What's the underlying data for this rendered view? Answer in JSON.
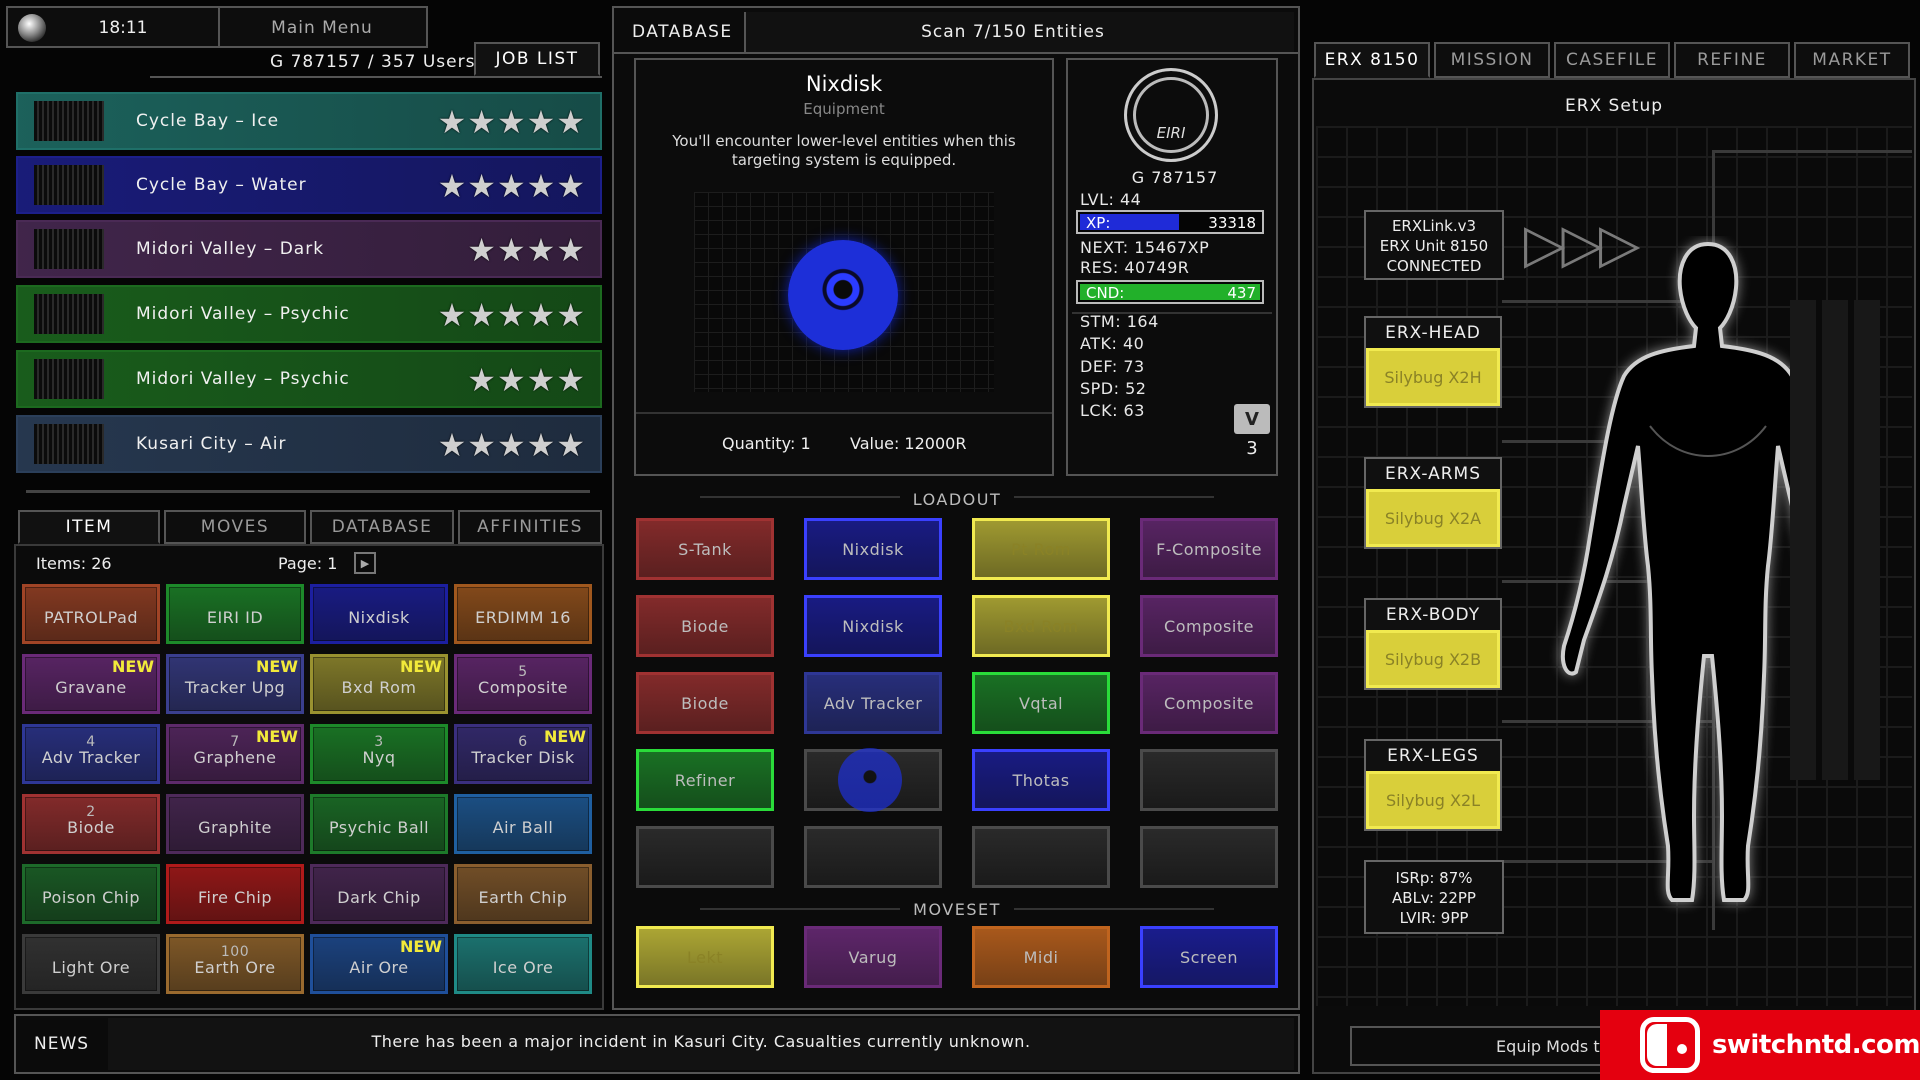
{
  "topbar": {
    "time": "18:11",
    "main_menu": "Main Menu",
    "users": "G 787157 / 357 Users",
    "job_list_tab": "JOB LIST"
  },
  "jobs": [
    {
      "name": "Cycle Bay – Ice",
      "stars": "★★★★★",
      "color": "#1f6f68"
    },
    {
      "name": "Cycle Bay – Water",
      "stars": "★★★★★",
      "color": "#1c1f8a"
    },
    {
      "name": "Midori Valley – Dark",
      "stars": "★★★★",
      "color": "#4a2a55"
    },
    {
      "name": "Midori Valley – Psychic",
      "stars": "★★★★★",
      "color": "#1c6a1f"
    },
    {
      "name": "Midori Valley – Psychic",
      "stars": "★★★★",
      "color": "#1c6a1f"
    },
    {
      "name": "Kusari City – Air",
      "stars": "★★★★★",
      "color": "#2b3f5a"
    }
  ],
  "bottom_tabs": [
    "ITEM",
    "MOVES",
    "DATABASE",
    "AFFINITIES"
  ],
  "items_info": {
    "count": "Items: 26",
    "page": "Page: 1",
    "page_arrow": "▶"
  },
  "items": [
    {
      "label": "PATROLPad",
      "count": "",
      "new": "",
      "color": "#a04426"
    },
    {
      "label": "EIRI ID",
      "count": "",
      "new": "",
      "color": "#1d8a2a"
    },
    {
      "label": "Nixdisk",
      "count": "",
      "new": "",
      "color": "#1c1fa0"
    },
    {
      "label": "ERDIMM 16",
      "count": "",
      "new": "",
      "color": "#a0581e"
    },
    {
      "label": "Gravane",
      "count": "",
      "new": "NEW",
      "color": "#6a2a78"
    },
    {
      "label": "Tracker Upg",
      "count": "",
      "new": "NEW",
      "color": "#3a3f8e"
    },
    {
      "label": "Bxd Rom",
      "count": "",
      "new": "NEW",
      "color": "#9a9230"
    },
    {
      "label": "Composite",
      "count": "5",
      "new": "",
      "color": "#6a2a78"
    },
    {
      "label": "Adv Tracker",
      "count": "4",
      "new": "",
      "color": "#2e3796"
    },
    {
      "label": "Graphene",
      "count": "7",
      "new": "NEW",
      "color": "#5d2a6a"
    },
    {
      "label": "Nyq",
      "count": "3",
      "new": "",
      "color": "#1d8a2a"
    },
    {
      "label": "Tracker Disk",
      "count": "6",
      "new": "NEW",
      "color": "#3a2f7e"
    },
    {
      "label": "Biode",
      "count": "2",
      "new": "",
      "color": "#a03232"
    },
    {
      "label": "Graphite",
      "count": "",
      "new": "",
      "color": "#4e2a5a"
    },
    {
      "label": "Psychic Ball",
      "count": "",
      "new": "",
      "color": "#1d7a2a"
    },
    {
      "label": "Air Ball",
      "count": "",
      "new": "",
      "color": "#1f5fa0"
    },
    {
      "label": "Poison Chip",
      "count": "",
      "new": "",
      "color": "#1d6a2a"
    },
    {
      "label": "Fire Chip",
      "count": "",
      "new": "",
      "color": "#b01a1a"
    },
    {
      "label": "Dark Chip",
      "count": "",
      "new": "",
      "color": "#4e2a5a"
    },
    {
      "label": "Earth Chip",
      "count": "",
      "new": "",
      "color": "#8a5e2e"
    },
    {
      "label": "Light Ore",
      "count": "",
      "new": "",
      "color": "#3a3a3a"
    },
    {
      "label": "Earth Ore",
      "count": "100",
      "new": "",
      "color": "#9a6a2e"
    },
    {
      "label": "Air Ore",
      "count": "",
      "new": "NEW",
      "color": "#1f4f9a"
    },
    {
      "label": "Ice Ore",
      "count": "",
      "new": "",
      "color": "#1f8a86"
    }
  ],
  "database": {
    "title": "DATABASE",
    "scan": "Scan 7/150 Entities",
    "item_name": "Nixdisk",
    "item_type": "Equipment",
    "description": "You'll encounter lower-level entities when this targeting system is equipped.",
    "quantity": "Quantity: 1",
    "value": "Value: 12000R"
  },
  "profile": {
    "logo": "EIRI",
    "id": "G 787157",
    "lvl": "LVL: 44",
    "xp_label": "XP:",
    "xp_value": "33318",
    "xp_fill": 0.55,
    "next": "NEXT: 15467XP",
    "res": "RES: 40749R",
    "cnd_label": "CND:",
    "cnd_value": "437",
    "cnd_fill": 1.0,
    "stm": "STM: 164",
    "atk": "ATK: 40",
    "def": "DEF: 73",
    "spd": "SPD: 52",
    "lck": "LCK: 63",
    "v_button": "V",
    "v_count": "3"
  },
  "loadout": {
    "title": "LOADOUT",
    "slots": [
      {
        "label": "S-Tank",
        "color": "#a03232"
      },
      {
        "label": "Nixdisk",
        "color": "#1c1fa0"
      },
      {
        "label": "Pt Rom",
        "color": "#c4bd3a"
      },
      {
        "label": "F-Composite",
        "color": "#6a2a78"
      },
      {
        "label": "Biode",
        "color": "#a03232"
      },
      {
        "label": "Nixdisk",
        "color": "#1c1fa0"
      },
      {
        "label": "Bxd Rom",
        "color": "#c4bd3a"
      },
      {
        "label": "Composite",
        "color": "#6a2a78"
      },
      {
        "label": "Biode",
        "color": "#a03232"
      },
      {
        "label": "Adv Tracker",
        "color": "#2e3796"
      },
      {
        "label": "Vqtal",
        "color": "#1d8a2a"
      },
      {
        "label": "Composite",
        "color": "#6a2a78"
      },
      {
        "label": "Refiner",
        "color": "#1d8a2a"
      },
      {
        "label": "",
        "color": "#3a3a3a"
      },
      {
        "label": "Thotas",
        "color": "#1c1fa0"
      },
      {
        "label": "",
        "color": "#2a2a2a"
      },
      {
        "label": "",
        "color": "#2a2a2a"
      },
      {
        "label": "",
        "color": "#2a2a2a"
      },
      {
        "label": "",
        "color": "#2a2a2a"
      },
      {
        "label": "",
        "color": "#2a2a2a"
      }
    ]
  },
  "moveset": {
    "title": "MOVESET",
    "slots": [
      {
        "label": "Lekt",
        "color": "#c4bd3a"
      },
      {
        "label": "Varug",
        "color": "#6a2a78"
      },
      {
        "label": "Midi",
        "color": "#c0641e"
      },
      {
        "label": "Screen",
        "color": "#1c1fa0"
      }
    ]
  },
  "right_tabs": [
    "ERX 8150",
    "MISSION",
    "CASEFILE",
    "REFINE",
    "MARKET"
  ],
  "erx": {
    "setup": "ERX Setup",
    "link": [
      "ERXLink.v3",
      "ERX Unit 8150",
      "CONNECTED"
    ],
    "play_arrows": "▷▷▷",
    "parts": [
      {
        "head": "ERX-HEAD",
        "mod": "Silybug X2H"
      },
      {
        "head": "ERX-ARMS",
        "mod": "Silybug X2A"
      },
      {
        "head": "ERX-BODY",
        "mod": "Silybug X2B"
      },
      {
        "head": "ERX-LEGS",
        "mod": "Silybug X2L"
      }
    ],
    "stats": [
      "ISRp: 87%",
      "ABLv: 22PP",
      "LVIR: 9PP"
    ],
    "equip_hint": "Equip Mods to y"
  },
  "news": {
    "label": "NEWS",
    "text": "There has been a major incident in Kasuri City. Casualties currently unknown."
  },
  "watermark": {
    "text": "switchntd.com"
  }
}
